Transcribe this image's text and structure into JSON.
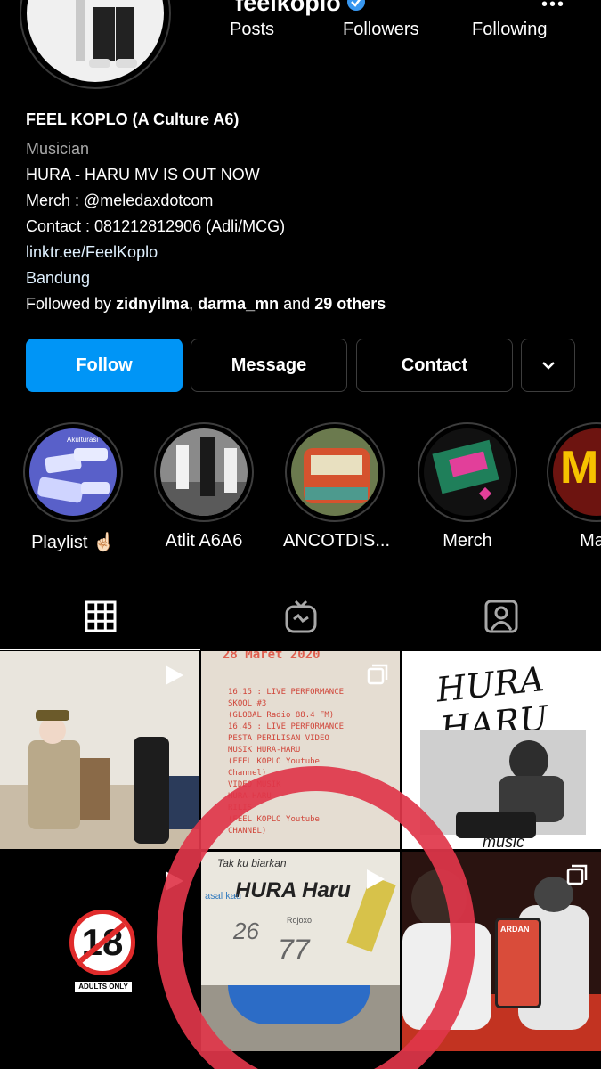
{
  "header": {
    "username": "feelkoplo",
    "back_icon": "back-arrow-icon",
    "verified_icon": "verified-badge-icon",
    "more_icon": "more-options-icon"
  },
  "stats": {
    "posts_label": "Posts",
    "followers_label": "Followers",
    "following_label": "Following"
  },
  "bio": {
    "name": "FEEL KOPLO (A Culture A6)",
    "category": "Musician",
    "line1": "HURA - HARU MV IS OUT NOW",
    "merch": "Merch : @meledaxdotcom",
    "contact": "Contact : 081212812906 (Adli/MCG)",
    "link": "linktr.ee/FeelKoplo",
    "location": "Bandung",
    "followed_by": "Followed by ",
    "followed_user1": "zidnyilma",
    "followed_sep": ", ",
    "followed_user2": "darma_mn",
    "followed_and": " and ",
    "followed_others": "29 others"
  },
  "actions": {
    "follow": "Follow",
    "message": "Message",
    "contact": "Contact",
    "dropdown_icon": "chevron-down-icon"
  },
  "highlights": [
    {
      "label": "Playlist ☝🏻"
    },
    {
      "label": "Atlit A6A6"
    },
    {
      "label": "ANCOTDIS..."
    },
    {
      "label": "Merch"
    },
    {
      "label": "Mas"
    }
  ],
  "tabs": {
    "grid_icon": "grid-icon",
    "igtv_icon": "igtv-icon",
    "tagged_icon": "tagged-icon"
  },
  "posts": {
    "p2_text": "28 Maret 2020",
    "p2_lines": [
      "16.15 : LIVE PERFORMANCE",
      "SKOOL #3",
      "(GLOBAL Radio 88.4 FM)",
      "16.45 : LIVE PERFORMANCE",
      "PESTA PERILISAN VIDEO",
      "MUSIK HURA-HARU",
      "(FEEL KOPLO Youtube",
      "Channel)",
      "VIDEO MUSIK",
      "HURA-HARU",
      "RILIS",
      "(FEEL KOPLO Youtube",
      "CHANNEL)"
    ],
    "p3_text": "HURA HARU",
    "p3_sub": "music",
    "p4_badge": "18",
    "p4_caption": "ADULTS ONLY",
    "p5_top": "Tak ku biarkan",
    "p5_title": "HURA Haru",
    "p5_n1": "26",
    "p5_n2": "77",
    "p5_side": "asal kau",
    "p5_small": "Rojoxo",
    "p6_tag": "ARDAN"
  }
}
